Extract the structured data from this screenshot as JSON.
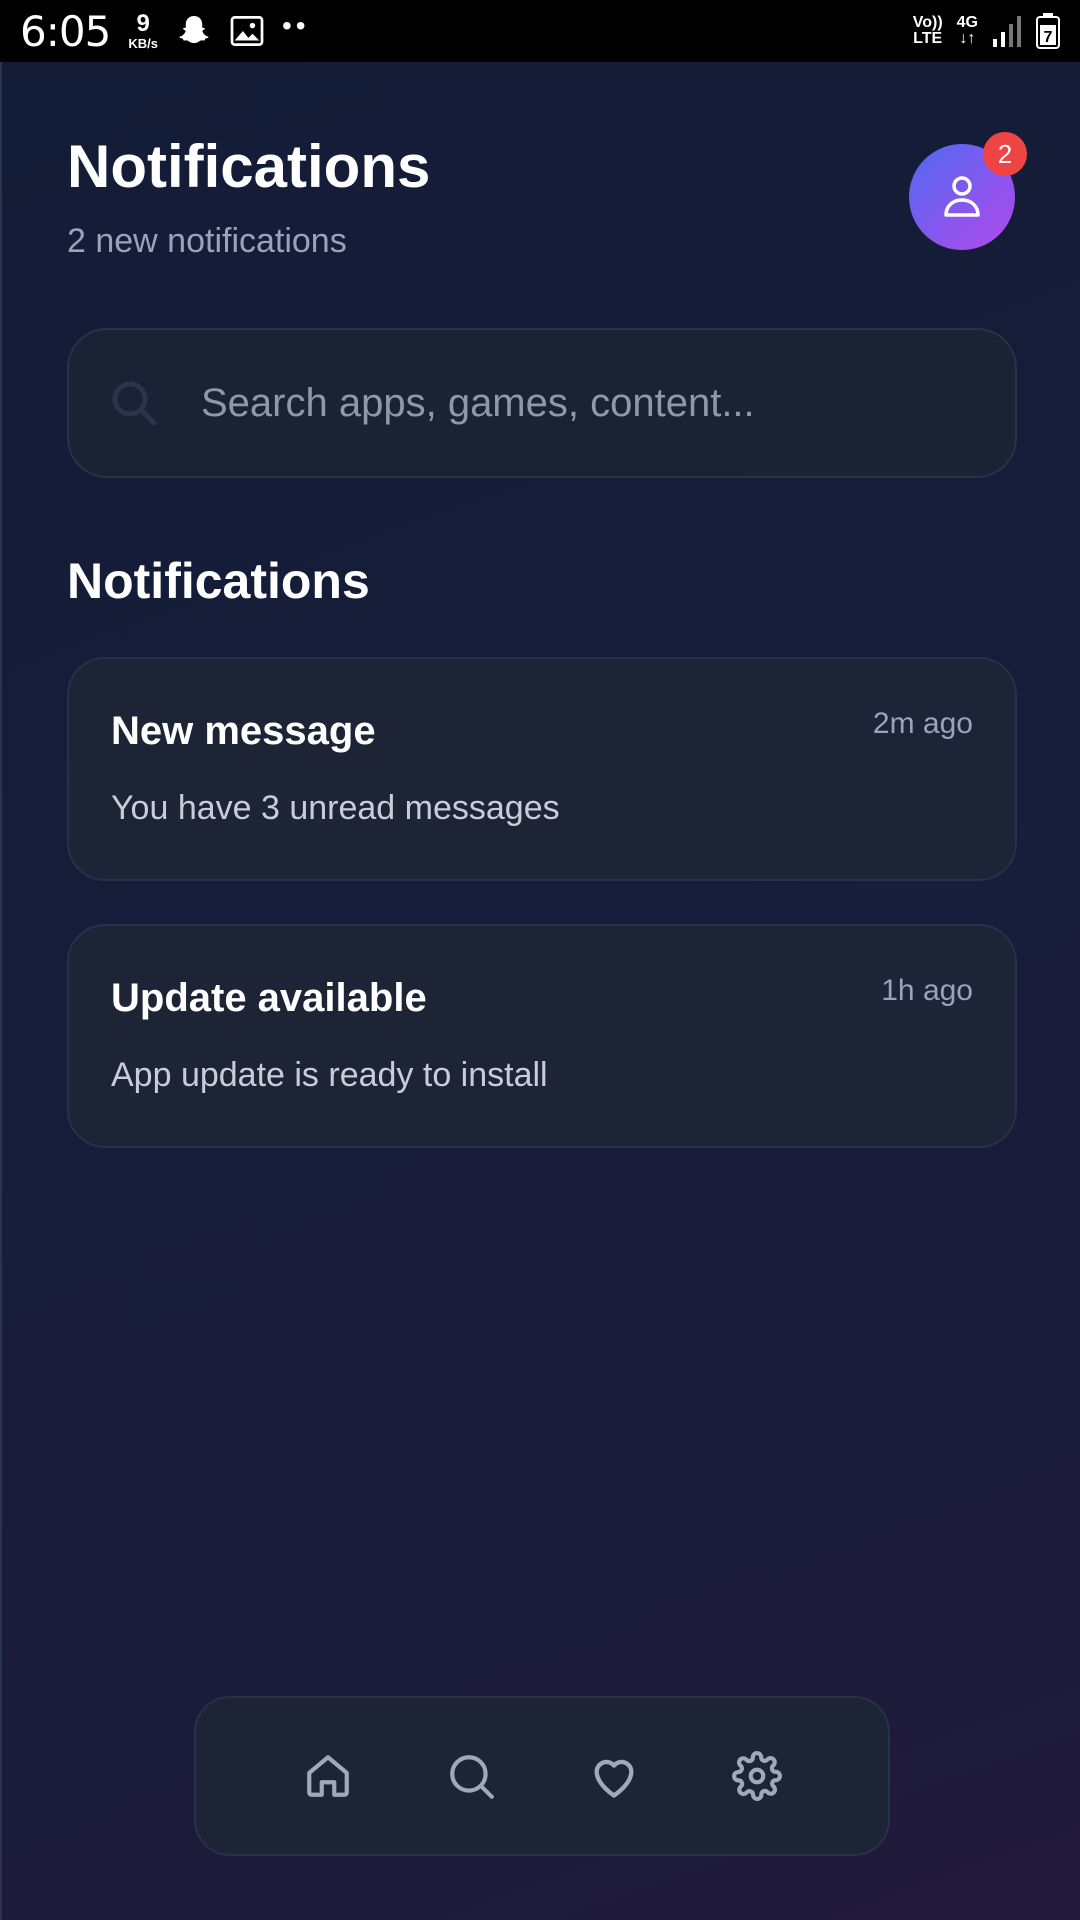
{
  "status_bar": {
    "time": "6:05",
    "speed_value": "9",
    "speed_unit": "KB/s",
    "network_tag_top": "Vo))",
    "network_tag_bottom": "LTE",
    "signal_tag_top": "4G",
    "signal_tag_bottom": "↓↑",
    "battery_level": "7"
  },
  "header": {
    "title": "Notifications",
    "subtitle": "2 new notifications",
    "badge_count": "2"
  },
  "search": {
    "placeholder": "Search apps, games, content..."
  },
  "section": {
    "title": "Notifications"
  },
  "notifications": [
    {
      "title": "New message",
      "time": "2m ago",
      "body": "You have 3 unread messages"
    },
    {
      "title": "Update available",
      "time": "1h ago",
      "body": "App update is ready to install"
    }
  ],
  "nav": {
    "items": [
      "home-icon",
      "search-icon",
      "heart-icon",
      "gear-icon"
    ]
  },
  "colors": {
    "background": "#151c38",
    "card": "#1d2436",
    "badge": "#ef4444",
    "avatar_start": "#4f6bf0",
    "avatar_end": "#b14ae8"
  }
}
